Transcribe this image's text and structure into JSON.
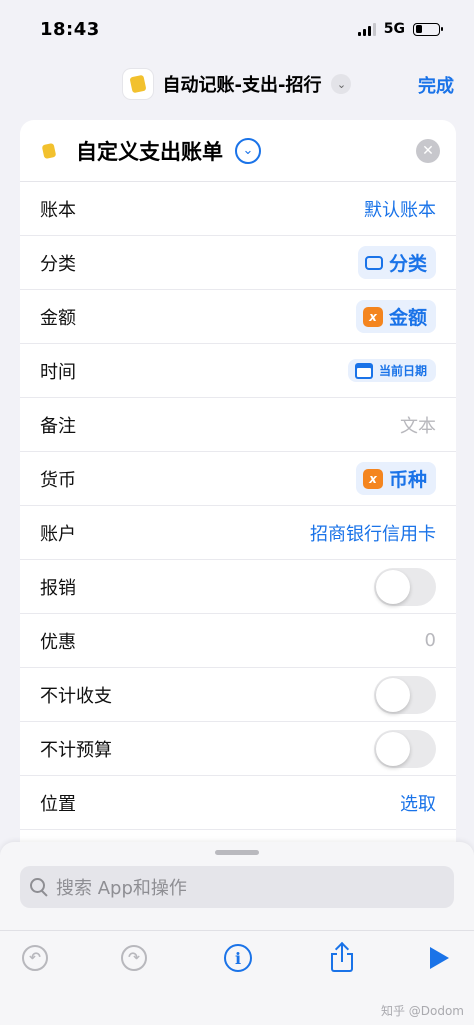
{
  "status_bar": {
    "time": "18:43",
    "network": "5G"
  },
  "nav": {
    "title": "自动记账-支出-招行",
    "done": "完成"
  },
  "action": {
    "title": "自定义支出账单"
  },
  "rows": {
    "ledger": {
      "label": "账本",
      "value": "默认账本"
    },
    "category": {
      "label": "分类",
      "value": "分类"
    },
    "amount": {
      "label": "金额",
      "value": "金额"
    },
    "time": {
      "label": "时间",
      "value": "当前日期"
    },
    "note": {
      "label": "备注",
      "placeholder": "文本"
    },
    "currency": {
      "label": "货币",
      "value": "币种"
    },
    "account": {
      "label": "账户",
      "value": "招商银行信用卡"
    },
    "reimburse": {
      "label": "报销",
      "on": false
    },
    "discount": {
      "label": "优惠",
      "placeholder": "0"
    },
    "exclude_income_expense": {
      "label": "不计收支",
      "on": false
    },
    "exclude_budget": {
      "label": "不计预算",
      "on": false
    },
    "location": {
      "label": "位置",
      "value": "选取"
    }
  },
  "search": {
    "placeholder": "搜索 App和操作"
  },
  "watermark": "知乎 @Dodom",
  "colors": {
    "accent": "#1a73e8",
    "variable": "#f4851f",
    "wallet": "#f2c12e"
  }
}
